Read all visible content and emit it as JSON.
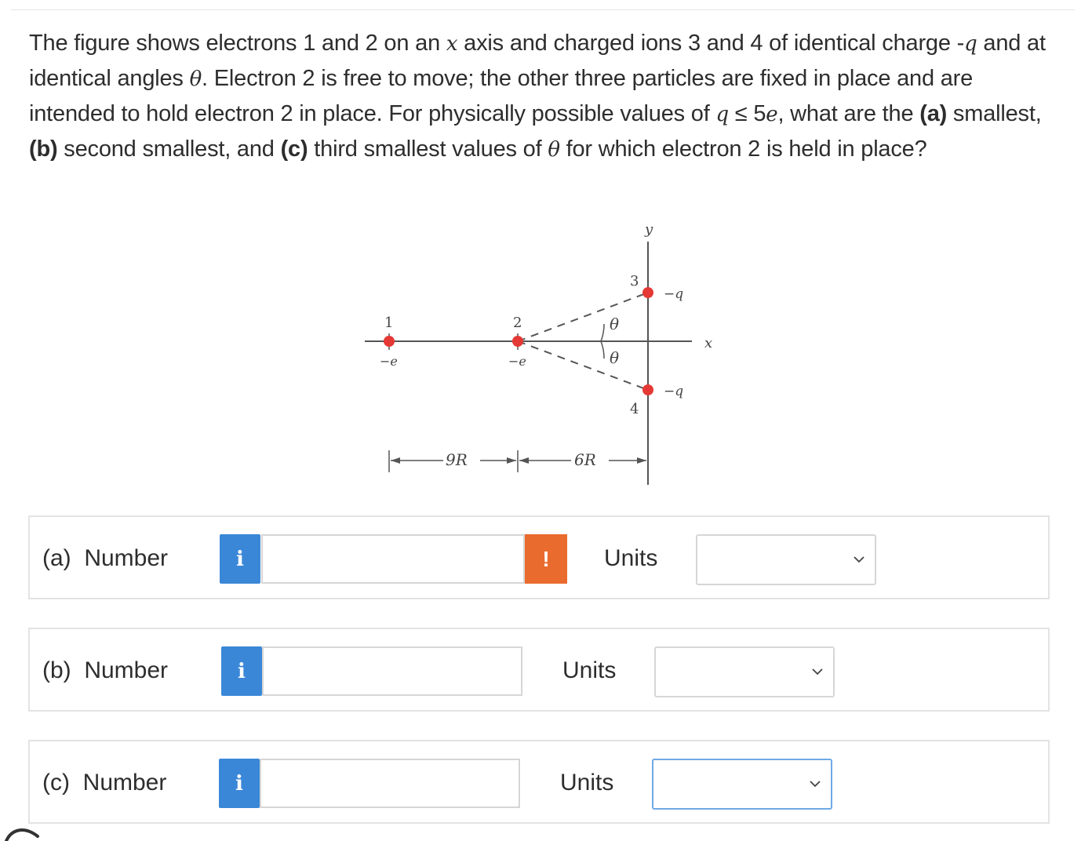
{
  "question": {
    "parts": [
      {
        "t": "The figure shows electrons 1 and 2 on an "
      },
      {
        "t": "x",
        "i": true
      },
      {
        "t": " axis and charged ions 3 and 4 of identical charge -"
      },
      {
        "t": "q",
        "i": true
      },
      {
        "t": " and at identical angles "
      },
      {
        "t": "θ",
        "i": true
      },
      {
        "t": ". Electron 2 is free to move; the other three particles are fixed in place and are intended to hold electron 2 in place. For physically possible values of "
      },
      {
        "t": "q",
        "i": true
      },
      {
        "t": " ≤ 5"
      },
      {
        "t": "e",
        "i": true
      },
      {
        "t": ", what are the "
      },
      {
        "t": "(a)",
        "b": true
      },
      {
        "t": " smallest, "
      },
      {
        "t": "(b)",
        "b": true
      },
      {
        "t": " second smallest, and "
      },
      {
        "t": "(c)",
        "b": true
      },
      {
        "t": " third smallest values of "
      },
      {
        "t": "θ",
        "i": true
      },
      {
        "t": " for which electron 2 is held in place?"
      }
    ]
  },
  "figure": {
    "y_axis_label": "y",
    "x_axis_label": "x",
    "particle1_label": "1",
    "particle1_charge": "−e",
    "particle2_label": "2",
    "particle2_charge": "−e",
    "ion3_label": "3",
    "ion3_charge": "−q",
    "ion4_label": "4",
    "ion4_charge": "−q",
    "theta_upper": "θ",
    "theta_lower": "θ",
    "distance_left": "9R",
    "distance_right": "6R",
    "particle_color": "#e53935"
  },
  "rows": [
    {
      "label": "(a)  Number",
      "info": "i",
      "value": "",
      "warn": "!",
      "units_label": "Units",
      "units_value": ""
    },
    {
      "label": "(b)  Number",
      "info": "i",
      "value": "",
      "units_label": "Units",
      "units_value": ""
    },
    {
      "label": "(c)  Number",
      "info": "i",
      "value": "",
      "units_label": "Units",
      "units_value": ""
    }
  ],
  "colors": {
    "info": "#3a87d8",
    "warn": "#ea6b2e",
    "focus": "#6fa9e6"
  }
}
